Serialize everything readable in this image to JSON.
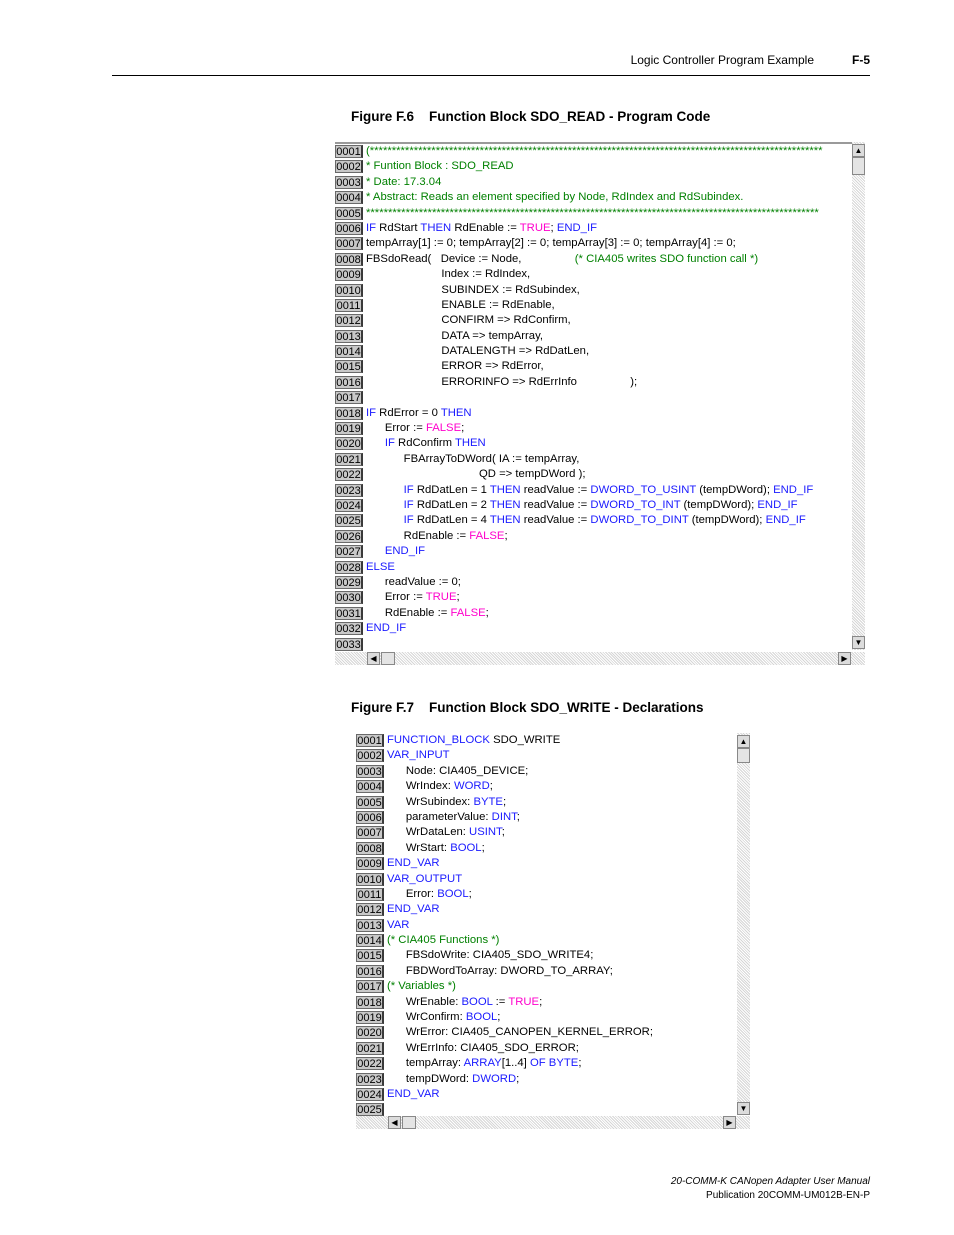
{
  "header": {
    "section_title": "Logic Controller Program Example",
    "page_number": "F-5"
  },
  "figure1": {
    "number": "Figure F.6",
    "title": "Function Block SDO_READ - Program Code",
    "lines": [
      {
        "n": "0001",
        "parts": [
          {
            "t": "(*******************************************************************************************************",
            "c": "cm"
          }
        ]
      },
      {
        "n": "0002",
        "parts": [
          {
            "t": "* Funtion Block : SDO_READ",
            "c": "cm"
          }
        ]
      },
      {
        "n": "0003",
        "parts": [
          {
            "t": "* Date: 17.3.04",
            "c": "cm"
          }
        ]
      },
      {
        "n": "0004",
        "parts": [
          {
            "t": "* Abstract: Reads an element specified by Node, RdIndex and RdSubindex.",
            "c": "cm"
          }
        ]
      },
      {
        "n": "0005",
        "parts": [
          {
            "t": "*******************************************************************************************************",
            "c": "cm"
          }
        ]
      },
      {
        "n": "0006",
        "parts": [
          {
            "t": "IF",
            "c": "kw"
          },
          {
            "t": " RdStart "
          },
          {
            "t": "THEN",
            "c": "kw"
          },
          {
            "t": " RdEnable := "
          },
          {
            "t": "TRUE",
            "c": "lit"
          },
          {
            "t": "; "
          },
          {
            "t": "END_IF",
            "c": "kw"
          }
        ]
      },
      {
        "n": "0007",
        "parts": [
          {
            "t": "tempArray[1] := 0; tempArray[2] := 0; tempArray[3] := 0; tempArray[4] := 0;"
          }
        ]
      },
      {
        "n": "0008",
        "parts": [
          {
            "t": "FBSdoRead(   Device := Node,                 "
          },
          {
            "t": "(* CIA405 writes SDO function call *)",
            "c": "cm"
          }
        ]
      },
      {
        "n": "0009",
        "parts": [
          {
            "t": "                        Index := RdIndex,"
          }
        ]
      },
      {
        "n": "0010",
        "parts": [
          {
            "t": "                        SUBINDEX := RdSubindex,"
          }
        ]
      },
      {
        "n": "0011",
        "parts": [
          {
            "t": "                        ENABLE := RdEnable,"
          }
        ]
      },
      {
        "n": "0012",
        "parts": [
          {
            "t": "                        CONFIRM => RdConfirm,"
          }
        ]
      },
      {
        "n": "0013",
        "parts": [
          {
            "t": "                        DATA => tempArray,"
          }
        ]
      },
      {
        "n": "0014",
        "parts": [
          {
            "t": "                        DATALENGTH => RdDatLen,"
          }
        ]
      },
      {
        "n": "0015",
        "parts": [
          {
            "t": "                        ERROR => RdError,"
          }
        ]
      },
      {
        "n": "0016",
        "parts": [
          {
            "t": "                        ERRORINFO => RdErrInfo                 );"
          }
        ]
      },
      {
        "n": "0017",
        "parts": [
          {
            "t": ""
          }
        ]
      },
      {
        "n": "0018",
        "parts": [
          {
            "t": "IF",
            "c": "kw"
          },
          {
            "t": " RdError = 0 "
          },
          {
            "t": "THEN",
            "c": "kw"
          }
        ]
      },
      {
        "n": "0019",
        "parts": [
          {
            "t": "      Error := "
          },
          {
            "t": "FALSE",
            "c": "lit"
          },
          {
            "t": ";"
          }
        ]
      },
      {
        "n": "0020",
        "parts": [
          {
            "t": "      "
          },
          {
            "t": "IF",
            "c": "kw"
          },
          {
            "t": " RdConfirm "
          },
          {
            "t": "THEN",
            "c": "kw"
          }
        ]
      },
      {
        "n": "0021",
        "parts": [
          {
            "t": "            FBArrayToDWord( IA := tempArray,"
          }
        ]
      },
      {
        "n": "0022",
        "parts": [
          {
            "t": "                                    QD => tempDWord );"
          }
        ]
      },
      {
        "n": "0023",
        "parts": [
          {
            "t": "            "
          },
          {
            "t": "IF",
            "c": "kw"
          },
          {
            "t": " RdDatLen = 1 "
          },
          {
            "t": "THEN",
            "c": "kw"
          },
          {
            "t": " readValue := "
          },
          {
            "t": "DWORD_TO_USINT",
            "c": "kw"
          },
          {
            "t": " (tempDWord); "
          },
          {
            "t": "END_IF",
            "c": "kw"
          }
        ]
      },
      {
        "n": "0024",
        "parts": [
          {
            "t": "            "
          },
          {
            "t": "IF",
            "c": "kw"
          },
          {
            "t": " RdDatLen = 2 "
          },
          {
            "t": "THEN",
            "c": "kw"
          },
          {
            "t": " readValue := "
          },
          {
            "t": "DWORD_TO_INT",
            "c": "kw"
          },
          {
            "t": " (tempDWord); "
          },
          {
            "t": "END_IF",
            "c": "kw"
          }
        ]
      },
      {
        "n": "0025",
        "parts": [
          {
            "t": "            "
          },
          {
            "t": "IF",
            "c": "kw"
          },
          {
            "t": " RdDatLen = 4 "
          },
          {
            "t": "THEN",
            "c": "kw"
          },
          {
            "t": " readValue := "
          },
          {
            "t": "DWORD_TO_DINT",
            "c": "kw"
          },
          {
            "t": " (tempDWord); "
          },
          {
            "t": "END_IF",
            "c": "kw"
          }
        ]
      },
      {
        "n": "0026",
        "parts": [
          {
            "t": "            RdEnable := "
          },
          {
            "t": "FALSE",
            "c": "lit"
          },
          {
            "t": ";"
          }
        ]
      },
      {
        "n": "0027",
        "parts": [
          {
            "t": "      "
          },
          {
            "t": "END_IF",
            "c": "kw"
          }
        ]
      },
      {
        "n": "0028",
        "parts": [
          {
            "t": "ELSE",
            "c": "kw"
          }
        ]
      },
      {
        "n": "0029",
        "parts": [
          {
            "t": "      readValue := 0;"
          }
        ]
      },
      {
        "n": "0030",
        "parts": [
          {
            "t": "      Error := "
          },
          {
            "t": "TRUE",
            "c": "lit"
          },
          {
            "t": ";"
          }
        ]
      },
      {
        "n": "0031",
        "parts": [
          {
            "t": "      RdEnable := "
          },
          {
            "t": "FALSE",
            "c": "lit"
          },
          {
            "t": ";"
          }
        ]
      },
      {
        "n": "0032",
        "parts": [
          {
            "t": "END_IF",
            "c": "kw"
          }
        ]
      },
      {
        "n": "0033",
        "parts": [
          {
            "t": ""
          }
        ]
      }
    ]
  },
  "figure2": {
    "number": "Figure F.7",
    "title": "Function Block SDO_WRITE - Declarations",
    "lines": [
      {
        "n": "0001",
        "parts": [
          {
            "t": "FUNCTION_BLOCK",
            "c": "kw"
          },
          {
            "t": " SDO_WRITE"
          }
        ]
      },
      {
        "n": "0002",
        "parts": [
          {
            "t": "VAR_INPUT",
            "c": "kw"
          }
        ]
      },
      {
        "n": "0003",
        "parts": [
          {
            "t": "      Node: CIA405_DEVICE;"
          }
        ]
      },
      {
        "n": "0004",
        "parts": [
          {
            "t": "      WrIndex: "
          },
          {
            "t": "WORD",
            "c": "kw"
          },
          {
            "t": ";"
          }
        ]
      },
      {
        "n": "0005",
        "parts": [
          {
            "t": "      WrSubindex: "
          },
          {
            "t": "BYTE",
            "c": "kw"
          },
          {
            "t": ";"
          }
        ]
      },
      {
        "n": "0006",
        "parts": [
          {
            "t": "      parameterValue: "
          },
          {
            "t": "DINT",
            "c": "kw"
          },
          {
            "t": ";"
          }
        ]
      },
      {
        "n": "0007",
        "parts": [
          {
            "t": "      WrDataLen: "
          },
          {
            "t": "USINT",
            "c": "kw"
          },
          {
            "t": ";"
          }
        ]
      },
      {
        "n": "0008",
        "parts": [
          {
            "t": "      WrStart: "
          },
          {
            "t": "BOOL",
            "c": "kw"
          },
          {
            "t": ";"
          }
        ]
      },
      {
        "n": "0009",
        "parts": [
          {
            "t": "END_VAR",
            "c": "kw"
          }
        ]
      },
      {
        "n": "0010",
        "parts": [
          {
            "t": "VAR_OUTPUT",
            "c": "kw"
          }
        ]
      },
      {
        "n": "0011",
        "parts": [
          {
            "t": "      Error: "
          },
          {
            "t": "BOOL",
            "c": "kw"
          },
          {
            "t": ";"
          }
        ]
      },
      {
        "n": "0012",
        "parts": [
          {
            "t": "END_VAR",
            "c": "kw"
          }
        ]
      },
      {
        "n": "0013",
        "parts": [
          {
            "t": "VAR",
            "c": "kw"
          }
        ]
      },
      {
        "n": "0014",
        "parts": [
          {
            "t": "(* CIA405 Functions *)",
            "c": "cm"
          }
        ]
      },
      {
        "n": "0015",
        "parts": [
          {
            "t": "      FBSdoWrite: CIA405_SDO_WRITE4;"
          }
        ]
      },
      {
        "n": "0016",
        "parts": [
          {
            "t": "      FBDWordToArray: DWORD_TO_ARRAY;"
          }
        ]
      },
      {
        "n": "0017",
        "parts": [
          {
            "t": "(* Variables *)",
            "c": "cm"
          }
        ]
      },
      {
        "n": "0018",
        "parts": [
          {
            "t": "      WrEnable: "
          },
          {
            "t": "BOOL",
            "c": "kw"
          },
          {
            "t": " := "
          },
          {
            "t": "TRUE",
            "c": "lit"
          },
          {
            "t": ";"
          }
        ]
      },
      {
        "n": "0019",
        "parts": [
          {
            "t": "      WrConfirm: "
          },
          {
            "t": "BOOL",
            "c": "kw"
          },
          {
            "t": ";"
          }
        ]
      },
      {
        "n": "0020",
        "parts": [
          {
            "t": "      WrError: CIA405_CANOPEN_KERNEL_ERROR;"
          }
        ]
      },
      {
        "n": "0021",
        "parts": [
          {
            "t": "      WrErrInfo: CIA405_SDO_ERROR;"
          }
        ]
      },
      {
        "n": "0022",
        "parts": [
          {
            "t": "      tempArray: "
          },
          {
            "t": "ARRAY",
            "c": "kw"
          },
          {
            "t": "[1..4] "
          },
          {
            "t": "OF",
            "c": "kw"
          },
          {
            "t": " "
          },
          {
            "t": "BYTE",
            "c": "kw"
          },
          {
            "t": ";"
          }
        ]
      },
      {
        "n": "0023",
        "parts": [
          {
            "t": "      tempDWord: "
          },
          {
            "t": "DWORD",
            "c": "kw"
          },
          {
            "t": ";"
          }
        ]
      },
      {
        "n": "0024",
        "parts": [
          {
            "t": "END_VAR",
            "c": "kw"
          }
        ]
      },
      {
        "n": "0025",
        "parts": [
          {
            "t": ""
          }
        ]
      }
    ]
  },
  "footer": {
    "manual_title": "20-COMM-K CANopen Adapter User Manual",
    "publication": "Publication 20COMM-UM012B-EN-P"
  },
  "colors": {
    "keyword": "#1a1aff",
    "literal": "#ff00cc",
    "comment": "#008000"
  }
}
